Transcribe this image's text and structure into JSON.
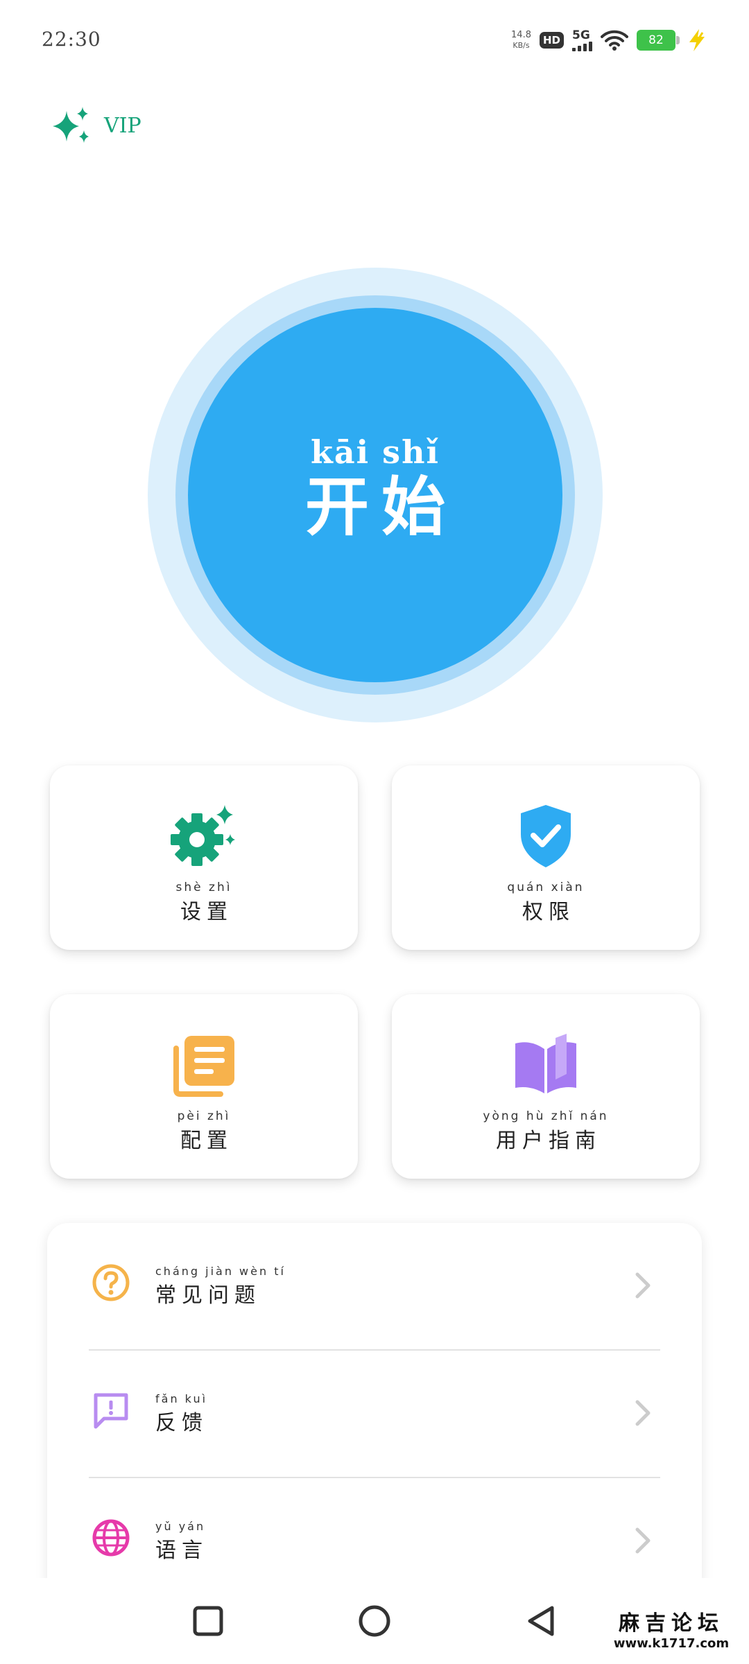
{
  "status_bar": {
    "time": "22:30",
    "net_speed": "14.8",
    "net_speed_unit": "KB/s",
    "hd": "HD",
    "network": "5G",
    "battery": "82"
  },
  "vip": {
    "label": "VIP",
    "color": "#16a37a"
  },
  "start": {
    "pinyin": "kāi shǐ",
    "label": "开始",
    "color": "#2eabf2"
  },
  "cards": [
    {
      "pinyin": "shè zhì",
      "label": "设置",
      "icon": "gear-sparkle-icon",
      "color": "#16a37a"
    },
    {
      "pinyin": "quán xiàn",
      "label": "权限",
      "icon": "shield-check-icon",
      "color": "#2eabf2"
    },
    {
      "pinyin": "pèi zhì",
      "label": "配置",
      "icon": "document-stack-icon",
      "color": "#f7b24c"
    },
    {
      "pinyin": "yòng hù zhǐ nán",
      "label": "用户指南",
      "icon": "book-icon",
      "color": "#a57af2"
    }
  ],
  "list": [
    {
      "pinyin": "cháng jiàn wèn tí",
      "label": "常见问题",
      "icon": "question-circle-icon",
      "color": "#f5b34a"
    },
    {
      "pinyin": "fǎn kuì",
      "label": "反馈",
      "icon": "feedback-icon",
      "color": "#b88cf0"
    },
    {
      "pinyin": "yǔ yán",
      "label": "语言",
      "icon": "globe-icon",
      "color": "#e63aaa"
    }
  ],
  "watermark": {
    "text": "麻吉论坛",
    "url": "www.k1717.com"
  }
}
